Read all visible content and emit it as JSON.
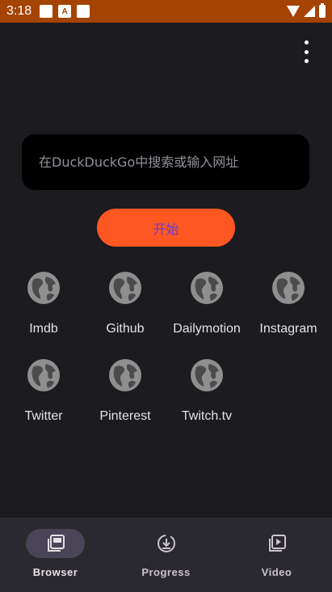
{
  "status_bar": {
    "time": "3:18",
    "notification_icons": [
      "square-icon",
      "font-a-icon",
      "square-icon"
    ],
    "right_icons": [
      "wifi-icon",
      "signal-icon",
      "battery-icon"
    ],
    "notification_letter": "A",
    "background_color": "#a54302"
  },
  "toolbar": {
    "more_icon": "more-vert-icon"
  },
  "search": {
    "placeholder": "在DuckDuckGo中搜索或输入网址",
    "value": ""
  },
  "start_button": {
    "label": "开始",
    "color": "#ff5722"
  },
  "shortcuts": [
    {
      "label": "Imdb",
      "icon": "globe-icon"
    },
    {
      "label": "Github",
      "icon": "globe-icon"
    },
    {
      "label": "Dailymotion",
      "icon": "globe-icon"
    },
    {
      "label": "Instagram",
      "icon": "globe-icon"
    },
    {
      "label": "Twitter",
      "icon": "globe-icon"
    },
    {
      "label": "Pinterest",
      "icon": "globe-icon"
    },
    {
      "label": "Twitch.tv",
      "icon": "globe-icon"
    }
  ],
  "bottom_nav": {
    "selected": "Browser",
    "items": [
      {
        "label": "Browser",
        "icon": "library-icon"
      },
      {
        "label": "Progress",
        "icon": "download-progress-icon"
      },
      {
        "label": "Video",
        "icon": "video-library-icon"
      }
    ]
  }
}
